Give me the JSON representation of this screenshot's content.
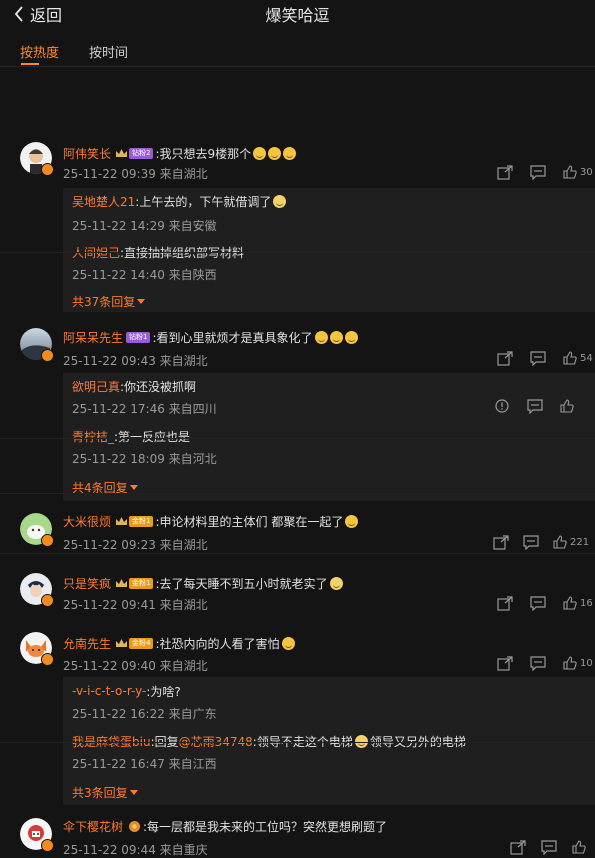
{
  "header": {
    "back_label": "返回",
    "title": "爆笑哈逗"
  },
  "sort_tabs": [
    {
      "label": "按热度",
      "active": true
    },
    {
      "label": "按时间",
      "active": false
    }
  ],
  "colors": {
    "accent": "#ff7a30",
    "background": "#141414"
  },
  "comments": [
    {
      "name": "阿伟笑长",
      "fan_badge": "钻粉2",
      "fan_badge_color": "#9b5bd6",
      "text": ":我只想去9楼那个",
      "meta": "25-11-22 09:39 来自湖北",
      "likes": "30",
      "replies": [
        {
          "name": "吴地楚人21",
          "text": ":上午去的，下午就借调了",
          "meta": "25-11-22 14:29 来自安徽"
        },
        {
          "name": "人间妲己",
          "text": ":直接抽掉组织部写材料",
          "meta": "25-11-22 14:40 来自陕西"
        }
      ],
      "more": "共37条回复"
    },
    {
      "name": "阿呆呆先生",
      "fan_badge": "钻粉1",
      "fan_badge_color": "#9b5bd6",
      "text": ":看到心里就烦才是真具象化了",
      "meta": "25-11-22 09:43 来自湖北",
      "likes": "54",
      "replies": [
        {
          "name": "欲明己真",
          "text": ":你还没被抓啊",
          "meta": "25-11-22 17:46 来自四川"
        },
        {
          "name": "青柠桔_",
          "text": ":第一反应也是",
          "meta": "25-11-22 18:09 来自河北"
        }
      ],
      "more": "共4条回复"
    },
    {
      "name": "大米很烦",
      "fan_badge": "金粉1",
      "fan_badge_color": "#e99b1a",
      "text": ":申论材料里的主体们 都聚在一起了",
      "meta": "25-11-22 09:23 来自湖北",
      "likes": "221"
    },
    {
      "name": "只是笑疯",
      "fan_badge": "金粉1",
      "fan_badge_color": "#e99b1a",
      "text": ":去了每天睡不到五小时就老实了",
      "meta": "25-11-22 09:41 来自湖北",
      "likes": "16"
    },
    {
      "name": "允南先生",
      "fan_badge": "金粉4",
      "fan_badge_color": "#e99b1a",
      "text": ":社恐内向的人看了害怕",
      "meta": "25-11-22 09:40 来自湖北",
      "likes": "10",
      "replies": [
        {
          "name": "-v-i-c-t-o-r-y-",
          "text": ":为啥?",
          "meta": "25-11-22 16:22 来自广东"
        },
        {
          "name": "我是麻袋蛋biu",
          "text_prefix": ":回复",
          "mention": "@芯雨34748",
          "text": ":领导不走这个电梯",
          "text2": "领导又另外的电梯",
          "meta": "25-11-22 16:47 来自江西"
        }
      ],
      "more": "共3条回复"
    },
    {
      "name": "伞下樱花树",
      "fan_badge": "",
      "fan_badge_color": "#e99b1a",
      "text": ":每一层都是我未来的工位吗？突然更想刷题了",
      "meta": "25-11-22 09:44 来自重庆",
      "likes": ""
    }
  ]
}
